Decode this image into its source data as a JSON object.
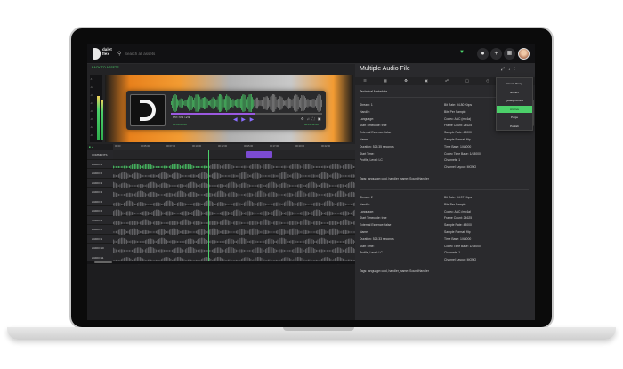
{
  "topbar": {
    "logo_text_1": "dalet",
    "logo_text_2": "flex",
    "search_placeholder": "Search all assets",
    "filter_icon": "filter-icon",
    "buttons": [
      "bell-icon",
      "plus-icon",
      "grid-icon"
    ]
  },
  "left": {
    "back_link": "BACK TO ASSETS",
    "meter_ticks": [
      "-6",
      "-12",
      "-18",
      "-24",
      "-30",
      "-36",
      "-42",
      "-48"
    ],
    "player": {
      "timecode": "00:03:24",
      "tc_in": "00:00:00:00",
      "tc_out": "00:23:52:00",
      "progress": 0.55
    },
    "ruler_ticks": [
      "00:00",
      "00:05:00",
      "00:07:00",
      "00:10:00",
      "00:12:00",
      "00:15:00",
      "00:17:00",
      "00:20:00",
      "00:22:00"
    ],
    "tracks": [
      "COMMENTS",
      "AUDIO 1",
      "AUDIO 2",
      "AUDIO 3",
      "AUDIO 4",
      "AUDIO 5",
      "AUDIO 6",
      "AUDIO 7",
      "AUDIO 8",
      "AUDIO 9",
      "AUDIO 10",
      "AUDIO 11"
    ]
  },
  "right": {
    "title": "Multiple Audio File",
    "section_title": "Technical Metadata",
    "streams": [
      {
        "left": [
          "Stream: 1",
          "Handle:",
          "Language:",
          "Start Timecode: true",
          "External Essence: false",
          "Name:",
          "Duration: 525.35 seconds",
          "Start Time:",
          "Profile, Level: LC"
        ],
        "right": [
          "Bit Rate: 94.80 Kbps",
          "Bits Per Sample:",
          "Codec: AAC (mp4a)",
          "Frame Count: 24625",
          "Sample Rate: 48000",
          "Sample Format: fltp",
          "Time Base: 1/48000",
          "Codec Time Base: 1/48000",
          "Channels: 1",
          "Channel Layout: MONO"
        ],
        "tags": "Tags: language=und, handler_name=SoundHandler"
      },
      {
        "left": [
          "Stream: 2",
          "Handle:",
          "Language:",
          "Start Timecode: true",
          "External Essence: false",
          "Name:",
          "Duration: 525.33 seconds",
          "Start Time:",
          "Profile, Level: LC"
        ],
        "right": [
          "Bit Rate: 94.97 Kbps",
          "Bits Per Sample:",
          "Codec: AAC (mp4a)",
          "Frame Count: 24625",
          "Sample Rate: 48000",
          "Sample Format: fltp",
          "Time Base: 1/48000",
          "Codec Time Base: 1/48000",
          "Channels: 1",
          "Channel Layout: MONO"
        ],
        "tags": "Tags: language=und, handler_name=SoundHandler"
      }
    ],
    "menu": [
      "Create Proxy",
      "Extract",
      "Quality Control",
      "Archive",
      "Purge",
      "Publish"
    ],
    "menu_active": "Archive"
  },
  "colors": {
    "accent_green": "#4cd06a",
    "accent_purple": "#9b59e0",
    "video_orange": "#f29b32"
  }
}
